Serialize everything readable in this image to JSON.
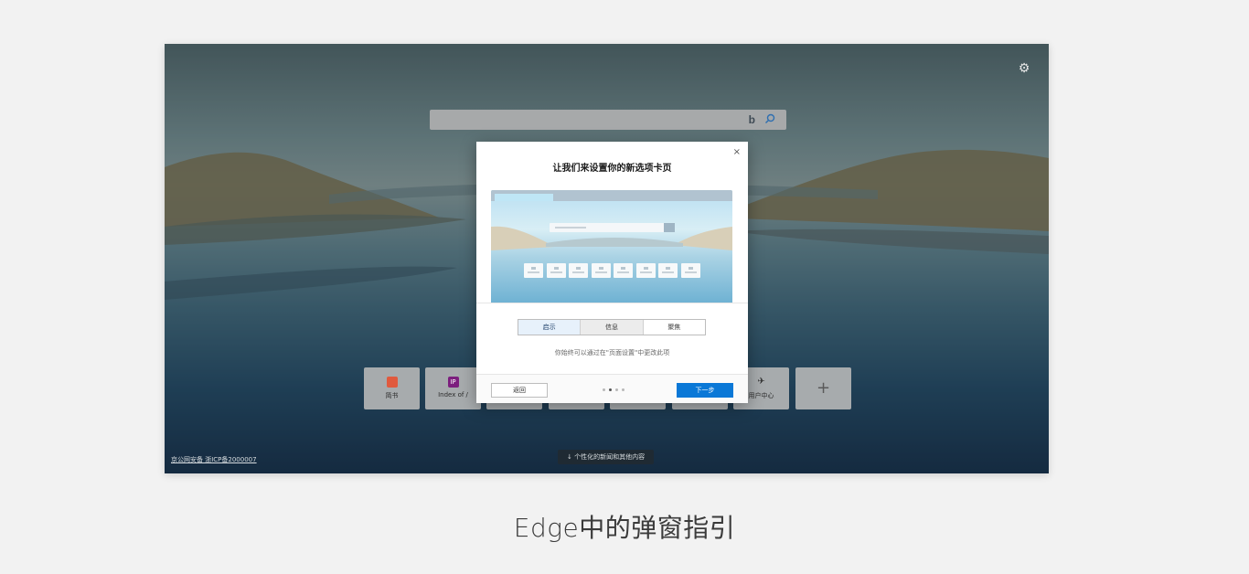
{
  "search": {
    "bing_label": "b"
  },
  "tiles": [
    {
      "label": "简书",
      "icon": "jianshu-icon",
      "color": "#e05a3e"
    },
    {
      "label": "Index of /",
      "icon": "ip-icon",
      "color": "#7c1f7e",
      "icon_text": "IP"
    },
    {
      "label": "",
      "icon": "",
      "color": ""
    },
    {
      "label": "",
      "icon": "",
      "color": ""
    },
    {
      "label": "",
      "icon": "",
      "color": ""
    },
    {
      "label": "",
      "icon": "",
      "color": ""
    },
    {
      "label": "用户中心",
      "icon": "rocket-icon",
      "color": "#333333"
    },
    {
      "label": "+",
      "icon": "plus-icon",
      "color": ""
    }
  ],
  "footer": {
    "license_link": "京公网安备 浙ICP备2000007",
    "news_button": "↓ 个性化的新闻和其他内容"
  },
  "dialog": {
    "title": "让我们来设置你的新选项卡页",
    "close": "×",
    "options": [
      "启示",
      "信息",
      "聚焦"
    ],
    "selected_option": "启示",
    "hint": "你始终可以通过在\"页面设置\"中更改此项",
    "back_label": "返回",
    "next_label": "下一步",
    "step_total": 4,
    "step_current": 2
  },
  "caption": "Edge中的弹窗指引"
}
